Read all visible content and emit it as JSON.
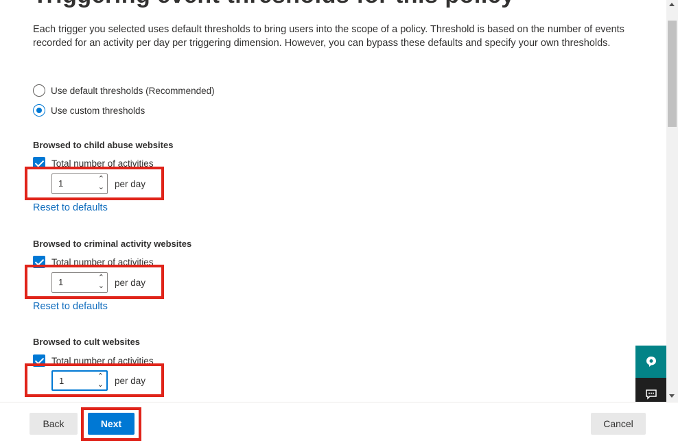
{
  "page": {
    "heading_partial": "Triggering event thresholds for this policy",
    "description": "Each trigger you selected uses default thresholds to bring users into the scope of a policy. Threshold is based on the number of events recorded for an activity per day per triggering dimension. However, you can bypass these defaults and specify your own thresholds."
  },
  "threshold_options": [
    {
      "label": "Use default thresholds (Recommended)",
      "selected": false
    },
    {
      "label": "Use custom thresholds",
      "selected": true
    }
  ],
  "sections": [
    {
      "title": "Browsed to child abuse websites",
      "checkbox_label": "Total number of activities",
      "value": "1",
      "unit": "per day",
      "reset": "Reset to defaults"
    },
    {
      "title": "Browsed to criminal activity websites",
      "checkbox_label": "Total number of activities",
      "value": "1",
      "unit": "per day",
      "reset": "Reset to defaults"
    },
    {
      "title": "Browsed to cult websites",
      "checkbox_label": "Total number of activities",
      "value": "1",
      "unit": "per day"
    }
  ],
  "footer": {
    "back": "Back",
    "next": "Next",
    "cancel": "Cancel"
  },
  "icons": {
    "help": "help-icon",
    "feedback": "feedback-icon"
  },
  "colors": {
    "accent": "#0078d4",
    "highlight": "#e0241a",
    "help_bg": "#038387",
    "feedback_bg": "#1f1f1f",
    "link": "#0f6cbd"
  }
}
